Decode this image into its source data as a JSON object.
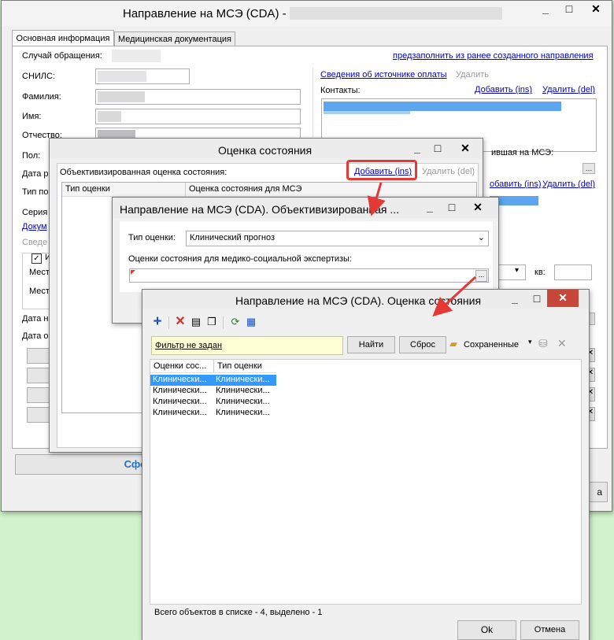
{
  "main_window": {
    "title": "Направление на МСЭ (CDA) -",
    "tabs": [
      "Основная информация",
      "Медицинская документация"
    ],
    "case_label": "Случай обращения:",
    "prefill_link": "предзаполнить из ранее созданного направления",
    "snils_label": "СНИЛС:",
    "surname_label": "Фамилия:",
    "name_label": "Имя:",
    "patronymic_label": "Отчество:",
    "sex_label": "Пол:",
    "birthdate_label": "Дата р",
    "doc_type_label": "Тип по",
    "series_label": "Серия",
    "doc_link": "Докум",
    "info_label": "Сведе",
    "checkbox_label": "И",
    "place_label1": "Мест",
    "place_label2": "Мест",
    "date_label1": "Дата н",
    "date_label2": "Дата о",
    "payment_link": "Сведения об источнике оплаты",
    "payment_delete": "Удалить",
    "contacts_label": "Контакты:",
    "contacts_add": "Добавить (ins)",
    "contacts_delete": "Удалить (del)",
    "sent_label": "ившая на МСЭ:",
    "add2": "обавить (ins)",
    "delete2": "Удалить (del)",
    "quarter_label": "кв:",
    "bottom_button": "Сфо",
    "bottom_right": "а"
  },
  "assess_window": {
    "title": "Оценка состояния",
    "section_label": "Объективизированная оценка состояния:",
    "add_link": "Добавить (ins)",
    "delete_link": "Удалить (del)",
    "columns": [
      "Тип оценки",
      "Оценка состояния для МСЭ"
    ]
  },
  "obj_window": {
    "title": "Направление на МСЭ (CDA). Объективизированная ...",
    "type_label": "Тип оценки:",
    "type_value": "Клинический прогноз",
    "assess_label": "Оценки состояния для медико-социальной экспертизы:",
    "ellipsis": "..."
  },
  "picker_window": {
    "title": "Направление на МСЭ (CDA). Оценка состояния",
    "filter_text": "Фильтр не задан",
    "find_button": "Найти",
    "reset_button": "Сброс",
    "saved_label": "Сохраненные",
    "columns": [
      "Оценки сос...",
      "Тип оценки"
    ],
    "rows": [
      [
        "Клинически...",
        "Клинически..."
      ],
      [
        "Клинически...",
        "Клинически..."
      ],
      [
        "Клинически...",
        "Клинически..."
      ],
      [
        "Клинически...",
        "Клинически..."
      ]
    ],
    "status": "Всего объектов в списке - 4, выделено - 1",
    "ok_button": "Ok",
    "cancel_button": "Отмена"
  },
  "colors": {
    "accent_red": "#e53935",
    "selection": "#3399ff",
    "link": "#0000cc"
  }
}
